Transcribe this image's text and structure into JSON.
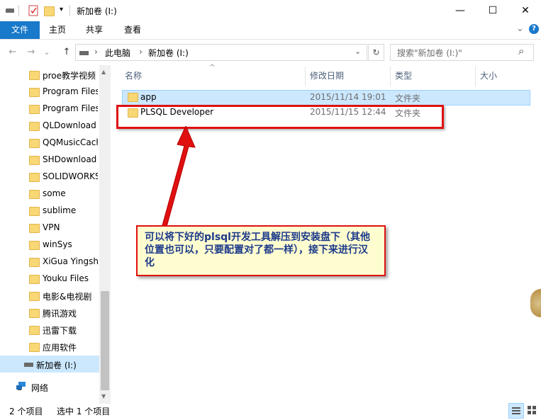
{
  "window": {
    "title": "新加卷 (I:)",
    "minimize_glyph": "—",
    "maximize_glyph": "☐",
    "close_glyph": "✕"
  },
  "ribbon": {
    "tabs": [
      "文件",
      "主页",
      "共享",
      "查看"
    ],
    "expand_glyph": "⌄",
    "help_glyph": "?"
  },
  "address": {
    "back_glyph": "←",
    "forward_glyph": "→",
    "recent_glyph": "⌄",
    "up_glyph": "↑",
    "crumbs": [
      "此电脑",
      "新加卷 (I:)"
    ],
    "sep": "›",
    "dropdown_glyph": "⌄",
    "refresh_glyph": "↻",
    "search_placeholder": "搜索\"新加卷 (I:)\"",
    "search_glyph": "⌕"
  },
  "sidebar": {
    "items": [
      "proe教学视频",
      "Program Files",
      "Program Files",
      "QLDownload",
      "QQMusicCach",
      "SHDownload",
      "SOLIDWORKS",
      "some",
      "sublime",
      "VPN",
      "winSys",
      "XiGua Yingshi",
      "Youku Files",
      "电影&电视剧",
      "腾讯游戏",
      "迅雷下载",
      "应用软件"
    ],
    "drive": "新加卷 (I:)",
    "network": "网络",
    "scroll_up": "▲",
    "scroll_down": "▼"
  },
  "columns": {
    "name": "名称",
    "modified": "修改日期",
    "type": "类型",
    "size": "大小",
    "sort_glyph": "^"
  },
  "files": [
    {
      "name": "app",
      "modified": "2015/11/14 19:01",
      "type": "文件夹"
    },
    {
      "name": "PLSQL Developer",
      "modified": "2015/11/15 12:44",
      "type": "文件夹"
    }
  ],
  "annotation": {
    "text": "可以将下好的plsql开发工具解压到安装盘下（其他位置也可以，只要配置对了都一样），接下来进行汉化",
    "color": "#e01010"
  },
  "status": {
    "count": "2 个项目",
    "selected": "选中 1 个项目"
  },
  "colors": {
    "accent": "#1979ca",
    "selection": "#cce8ff",
    "folder": "#f8d775"
  }
}
